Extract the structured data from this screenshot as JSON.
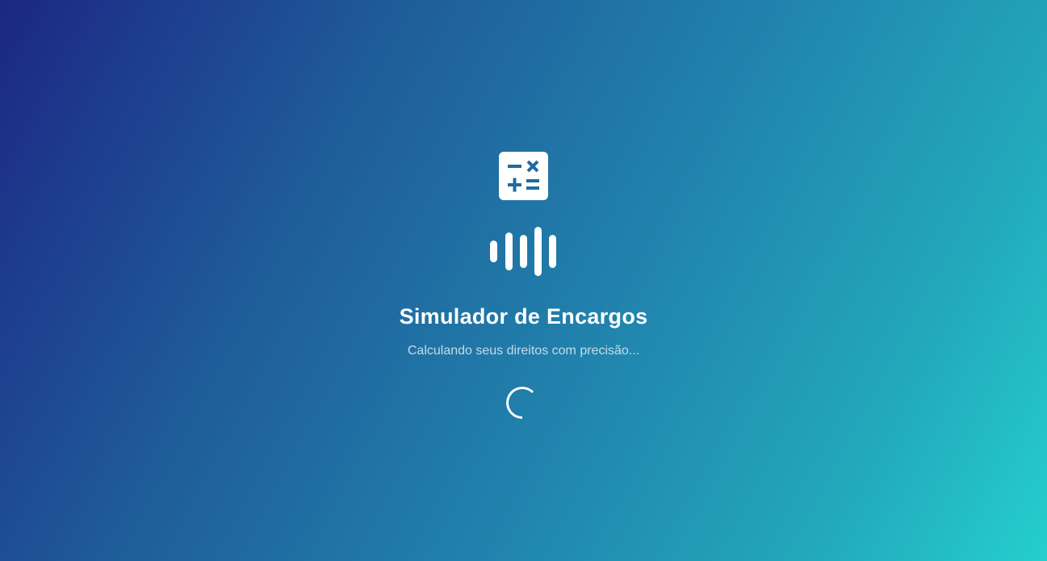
{
  "splash": {
    "title": "Simulador de Encargos",
    "subtitle": "Calculando seus direitos com precisão..."
  },
  "icons": {
    "logo": "calculator-icon",
    "activity": "sound-wave-icon",
    "loading": "loading-spinner-icon"
  },
  "colors": {
    "gradient_start": "#1c2784",
    "gradient_end": "#25cfcd",
    "icon_fill": "#ffffff",
    "icon_symbols": "#1f6aa0",
    "subtitle_text": "#c3dde8"
  }
}
